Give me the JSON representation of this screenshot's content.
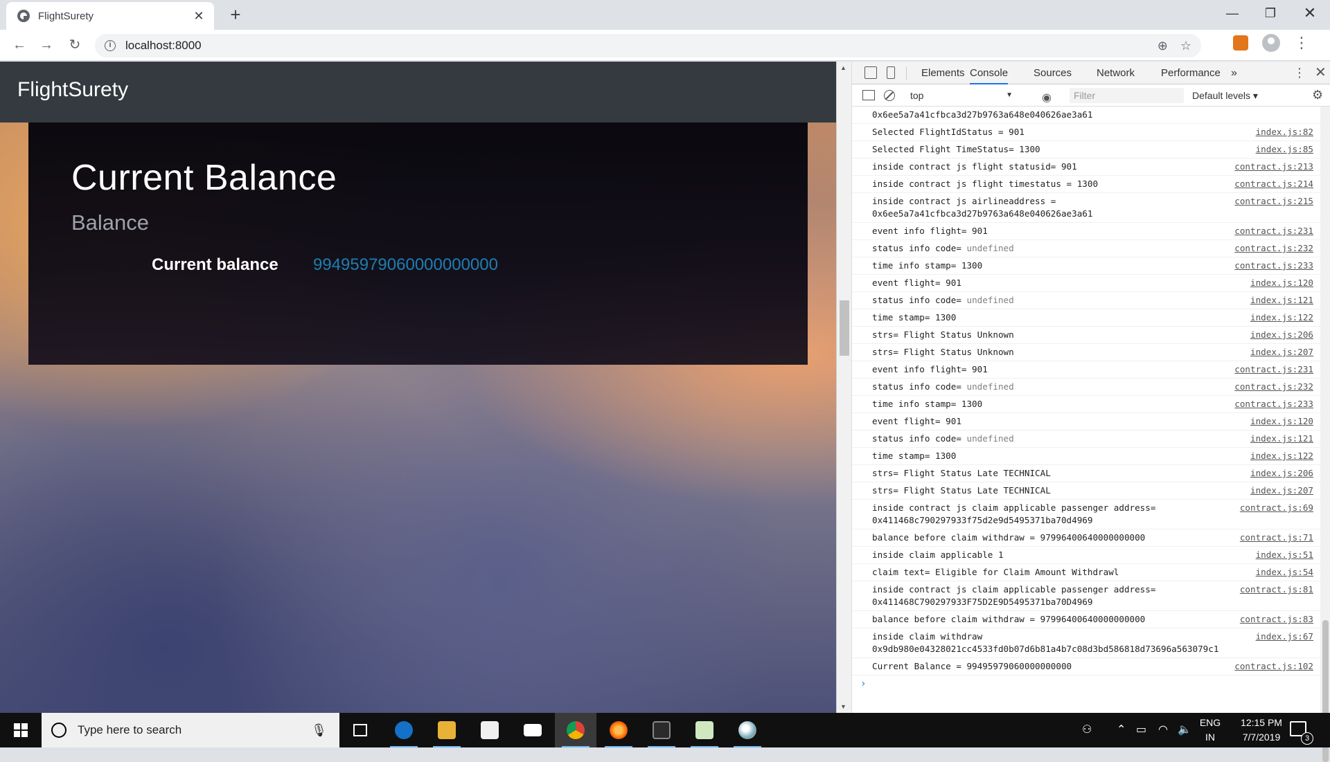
{
  "browser": {
    "tab_title": "FlightSurety",
    "tab_close": "✕",
    "new_tab": "+",
    "url": "localhost:8000",
    "win_min": "—",
    "win_max": "❐",
    "win_close": "✕"
  },
  "page": {
    "brand": "FlightSurety",
    "heading": "Current Balance",
    "subheading": "Balance",
    "balance_label": "Current balance",
    "balance_value": "99495979060000000000"
  },
  "devtools": {
    "tabs": [
      "Elements",
      "Console",
      "Sources",
      "Network",
      "Performance"
    ],
    "active_tab": "Console",
    "more": "»",
    "context": "top",
    "filter_placeholder": "Filter",
    "levels": "Default levels ▾",
    "logs": [
      {
        "msg": "0x6ee5a7a41cfbca3d27b9763a648e040626ae3a61",
        "src": ""
      },
      {
        "msg": "Selected FlightIdStatus = 901",
        "src": "index.js:82"
      },
      {
        "msg": "Selected Flight TimeStatus= 1300",
        "src": "index.js:85"
      },
      {
        "msg": "inside contract js flight statusid= 901",
        "src": "contract.js:213"
      },
      {
        "msg": "inside contract js flight timestatus = 1300",
        "src": "contract.js:214"
      },
      {
        "msg": "inside contract js airlineaddress = \n0x6ee5a7a41cfbca3d27b9763a648e040626ae3a61",
        "src": "contract.js:215"
      },
      {
        "msg": "event info flight= 901",
        "src": "contract.js:231"
      },
      {
        "msg": "status info code= ",
        "undef": "undefined",
        "src": "contract.js:232"
      },
      {
        "msg": "time info stamp= 1300",
        "src": "contract.js:233"
      },
      {
        "msg": "event flight= 901",
        "src": "index.js:120"
      },
      {
        "msg": "status info code= ",
        "undef": "undefined",
        "src": "index.js:121"
      },
      {
        "msg": "time stamp= 1300",
        "src": "index.js:122"
      },
      {
        "msg": "strs= Flight Status Unknown",
        "src": "index.js:206"
      },
      {
        "msg": "strs= Flight Status Unknown",
        "src": "index.js:207"
      },
      {
        "msg": "event info flight= 901",
        "src": "contract.js:231"
      },
      {
        "msg": "status info code= ",
        "undef": "undefined",
        "src": "contract.js:232"
      },
      {
        "msg": "time info stamp= 1300",
        "src": "contract.js:233"
      },
      {
        "msg": "event flight= 901",
        "src": "index.js:120"
      },
      {
        "msg": "status info code= ",
        "undef": "undefined",
        "src": "index.js:121"
      },
      {
        "msg": "time stamp= 1300",
        "src": "index.js:122"
      },
      {
        "msg": "strs= Flight Status Late TECHNICAL",
        "src": "index.js:206"
      },
      {
        "msg": "strs= Flight Status Late TECHNICAL",
        "src": "index.js:207"
      },
      {
        "msg": "inside contract js claim applicable passenger address=\n0x411468c790297933f75d2e9d5495371ba70d4969",
        "src": "contract.js:69"
      },
      {
        "msg": "balance before claim withdraw = 97996400640000000000",
        "src": "contract.js:71"
      },
      {
        "msg": "inside claim applicable 1",
        "src": "index.js:51"
      },
      {
        "msg": "claim text= Eligible for Claim Amount Withdrawl",
        "src": "index.js:54"
      },
      {
        "msg": "inside contract js claim applicable passenger address=\n0x411468C790297933F75D2E9D5495371ba70D4969",
        "src": "contract.js:81"
      },
      {
        "msg": "balance before claim withdraw = 97996400640000000000",
        "src": "contract.js:83"
      },
      {
        "msg": "inside claim withdraw\n0x9db980e04328021cc4533fd0b07d6b81a4b7c08d3bd586818d73696a563079c1",
        "src": "index.js:67"
      },
      {
        "msg": "Current Balance = 99495979060000000000",
        "src": "contract.js:102"
      }
    ],
    "prompt": "›"
  },
  "taskbar": {
    "search_placeholder": "Type here to search",
    "time": "12:15 PM",
    "date": "7/7/2019",
    "lang_top": "ENG",
    "lang_bottom": "IN",
    "notification_count": "3"
  }
}
